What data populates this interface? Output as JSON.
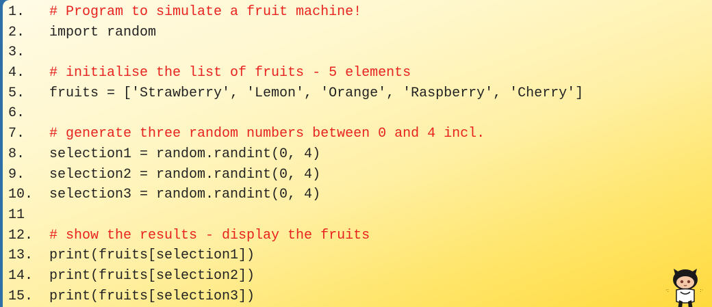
{
  "code": {
    "lines": [
      {
        "num": "1.",
        "text": "# Program to simulate a fruit machine!",
        "comment": true
      },
      {
        "num": "2.",
        "text": "import random",
        "comment": false
      },
      {
        "num": "3.",
        "text": "",
        "comment": false
      },
      {
        "num": "4.",
        "text": "# initialise the list of fruits - 5 elements",
        "comment": true
      },
      {
        "num": "5.",
        "text": "fruits = ['Strawberry', 'Lemon', 'Orange', 'Raspberry', 'Cherry']",
        "comment": false
      },
      {
        "num": "6.",
        "text": "",
        "comment": false
      },
      {
        "num": "7.",
        "text": "# generate three random numbers between 0 and 4 incl.",
        "comment": true
      },
      {
        "num": "8.",
        "text": "selection1 = random.randint(0, 4)",
        "comment": false
      },
      {
        "num": "9.",
        "text": "selection2 = random.randint(0, 4)",
        "comment": false
      },
      {
        "num": "10.",
        "text": "selection3 = random.randint(0, 4)",
        "comment": false
      },
      {
        "num": "11",
        "text": "",
        "comment": false
      },
      {
        "num": "12.",
        "text": "# show the results - display the fruits",
        "comment": true
      },
      {
        "num": "13.",
        "text": "print(fruits[selection1])",
        "comment": false
      },
      {
        "num": "14.",
        "text": "print(fruits[selection2])",
        "comment": false
      },
      {
        "num": "15.",
        "text": "print(fruits[selection3])",
        "comment": false
      }
    ]
  },
  "colors": {
    "comment": "#e8231f",
    "code": "#222222",
    "background_top": "#fffbe6",
    "background_bottom": "#ffd93d"
  },
  "mascot": {
    "icon": "octocat-icon"
  }
}
